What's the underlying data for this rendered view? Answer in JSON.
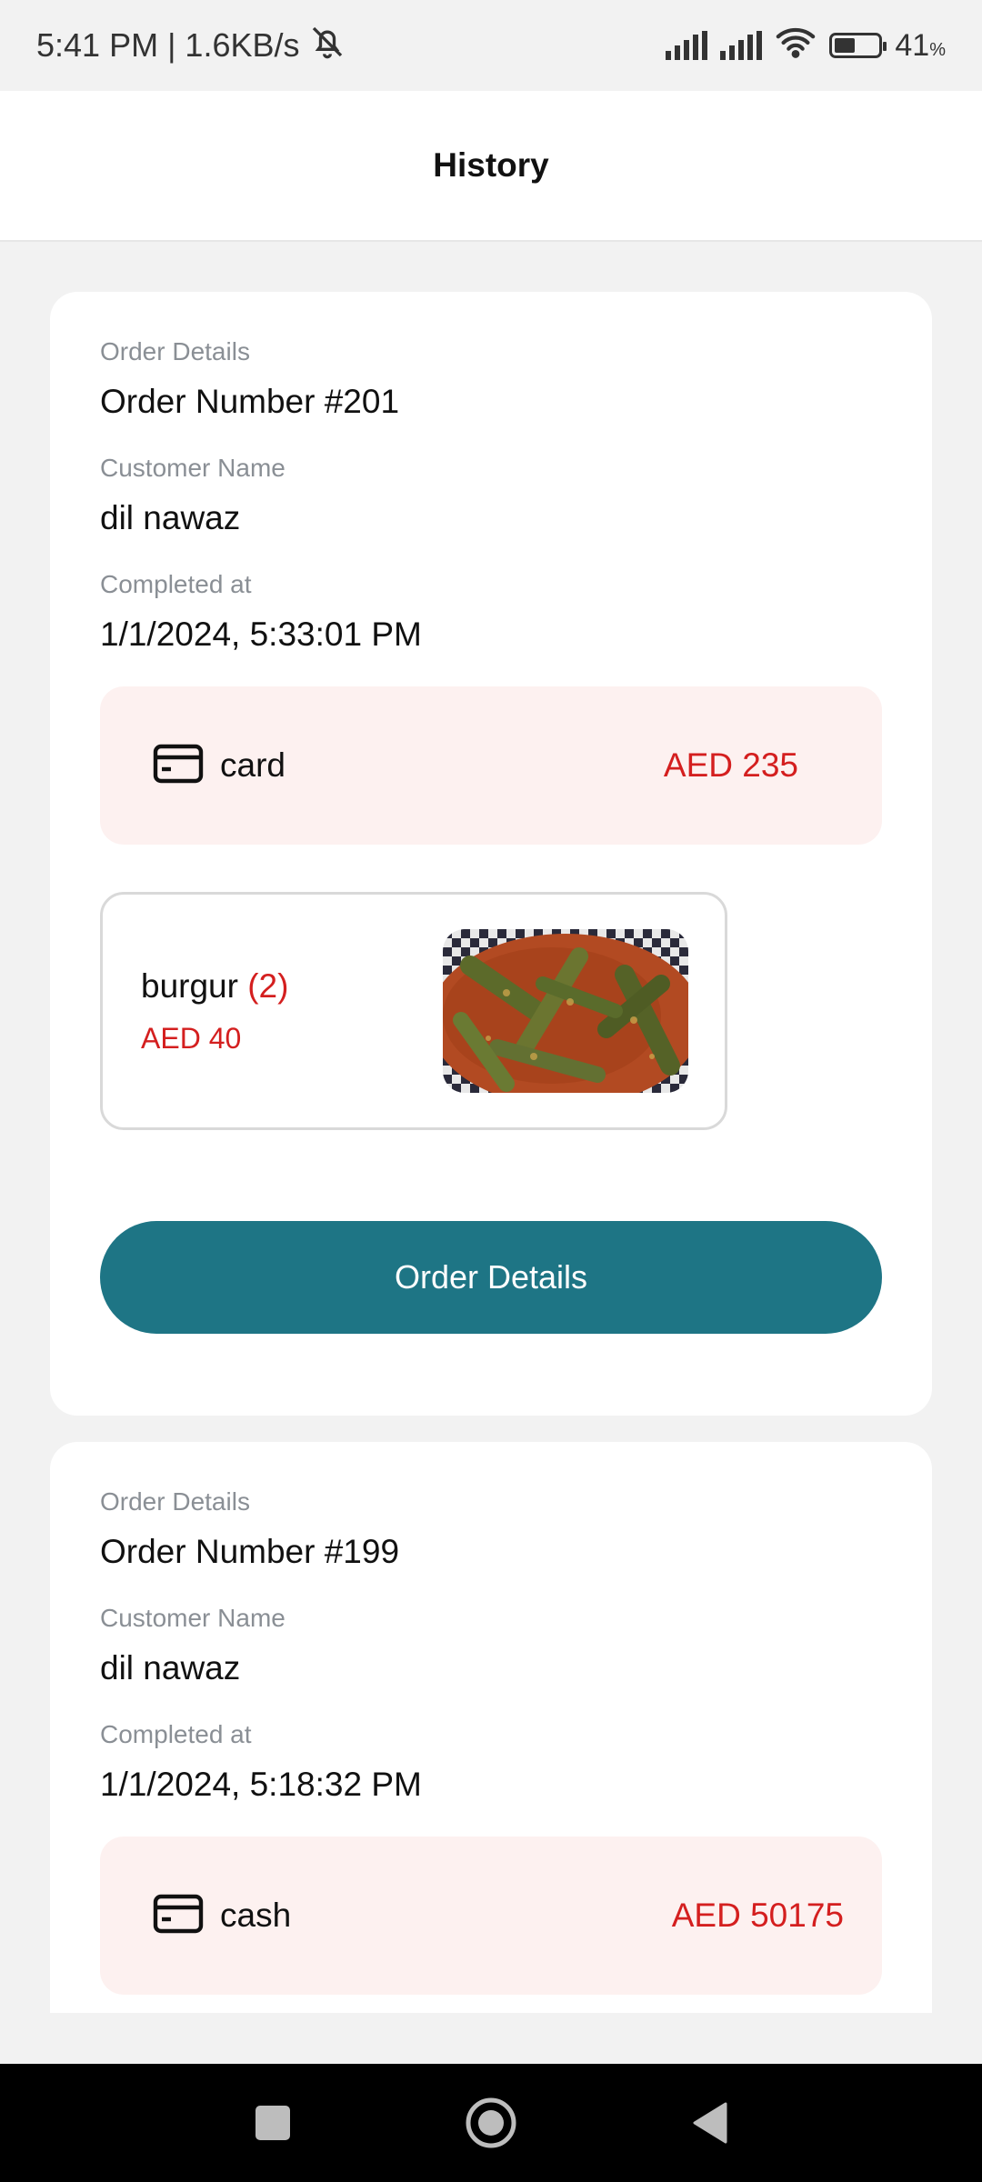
{
  "status_bar": {
    "time_speed": "5:41 PM | 1.6KB/s",
    "battery_pct": "41",
    "battery_unit": "%",
    "icons": [
      "bell-off-icon",
      "signal-icon",
      "signal-icon",
      "wifi-icon",
      "battery-icon"
    ]
  },
  "header": {
    "title": "History"
  },
  "colors": {
    "accent": "#1e7585",
    "price_red": "#d41f1f",
    "pay_bg": "#fdf1f0"
  },
  "orders": [
    {
      "details_label": "Order Details",
      "order_number": "Order Number #201",
      "customer_label": "Customer Name",
      "customer_name": "dil nawaz",
      "completed_label": "Completed at",
      "completed_at": "1/1/2024, 5:33:01 PM",
      "payment_method": "card",
      "total": "AED 235",
      "items": [
        {
          "name": "burgur",
          "qty": "(2)",
          "price": "AED 40",
          "image": "okra-stew-photo"
        }
      ],
      "button_label": "Order Details"
    },
    {
      "details_label": "Order Details",
      "order_number": "Order Number #199",
      "customer_label": "Customer Name",
      "customer_name": "dil nawaz",
      "completed_label": "Completed at",
      "completed_at": "1/1/2024, 5:18:32 PM",
      "payment_method": "cash",
      "total": "AED 50175"
    }
  ],
  "nav": {
    "icons": [
      "recents-square-icon",
      "home-circle-icon",
      "back-triangle-icon"
    ]
  }
}
